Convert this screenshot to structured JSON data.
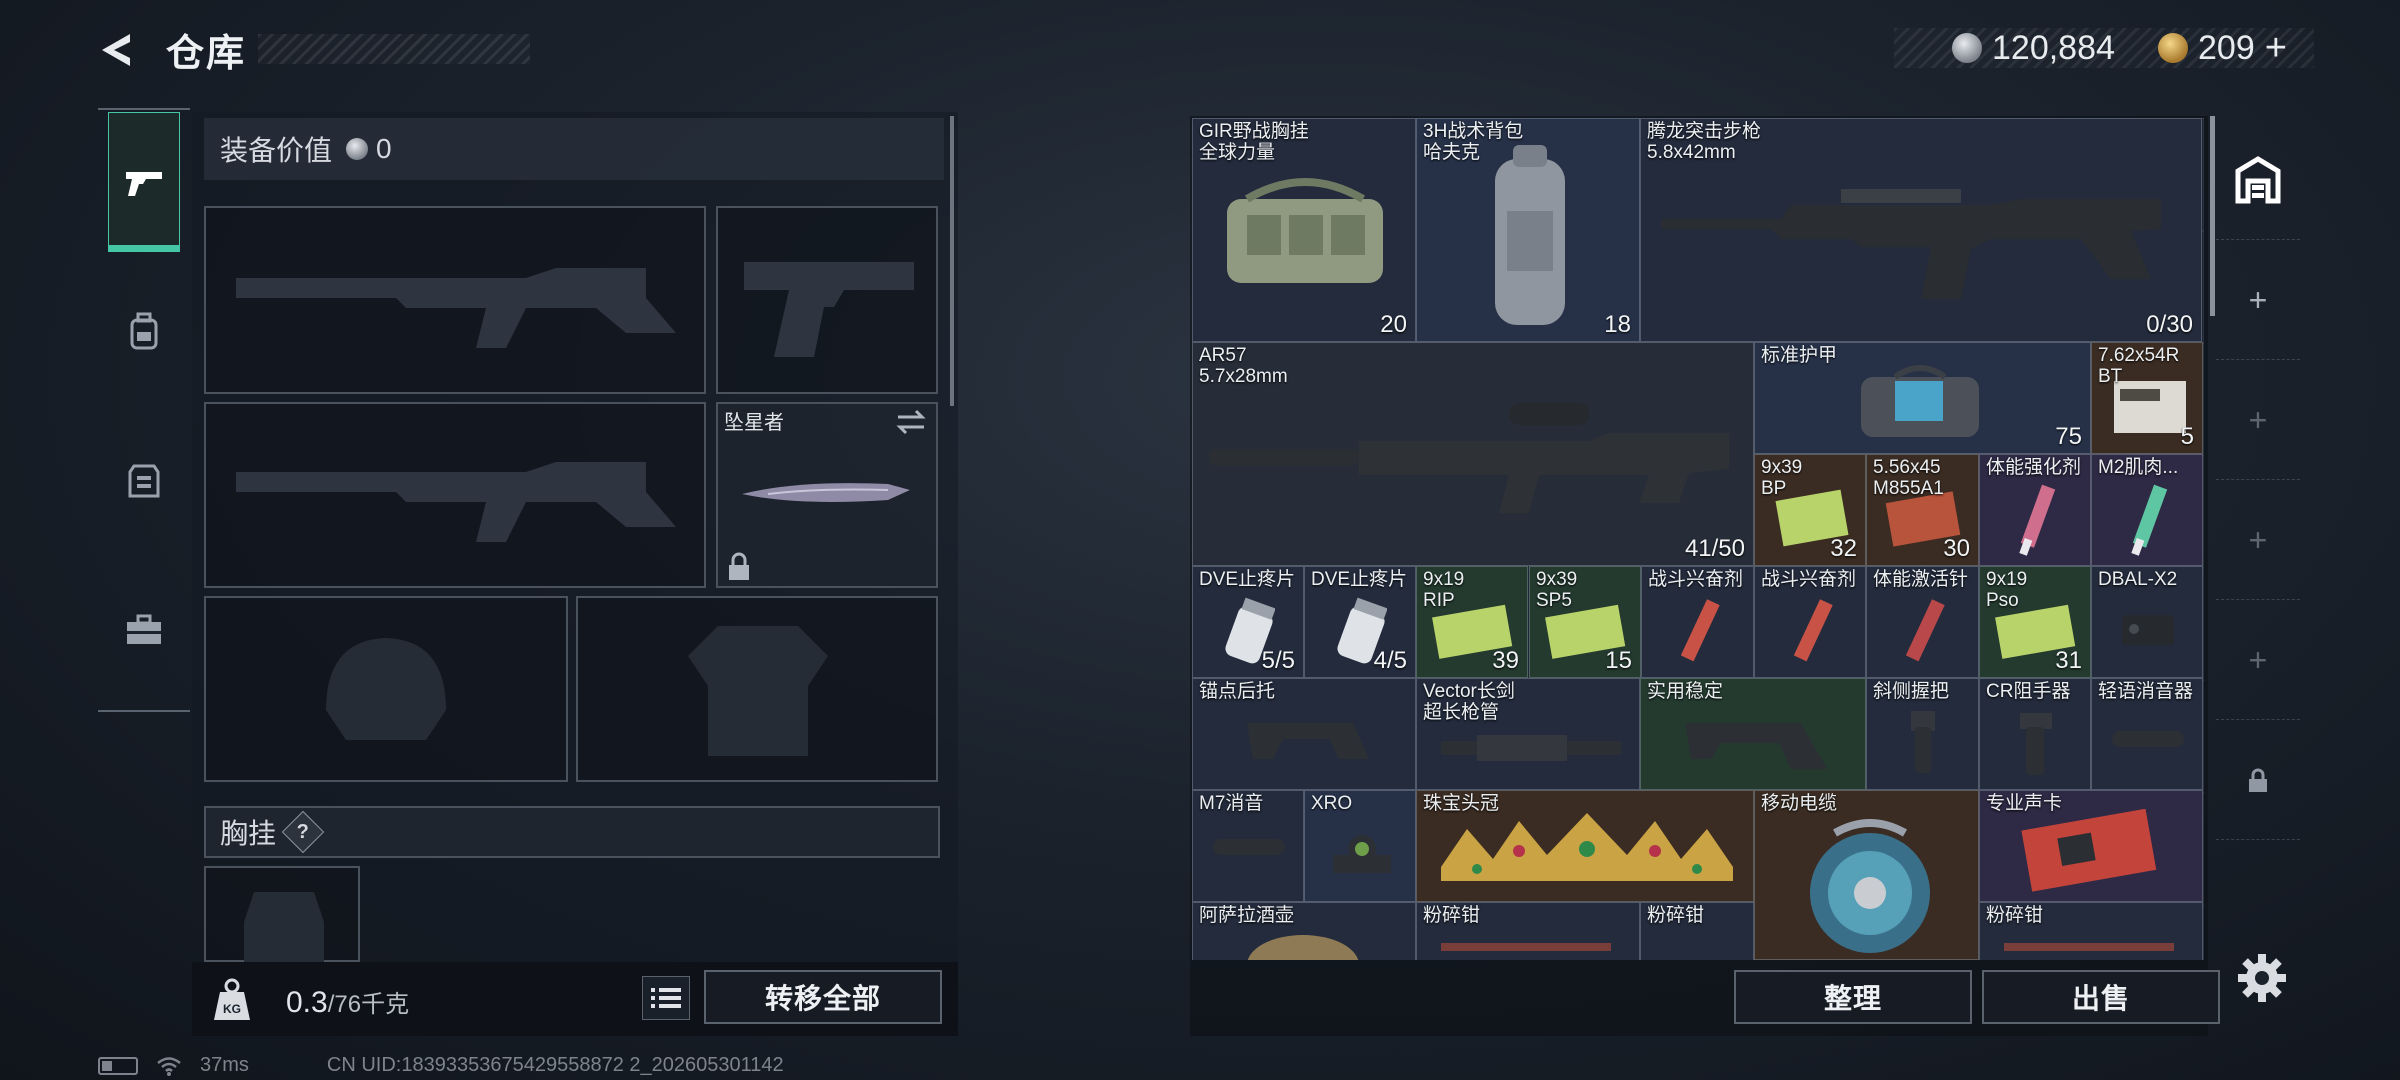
{
  "header": {
    "title": "仓库",
    "currency_silver": "120,884",
    "currency_gold": "209",
    "add_symbol": "+"
  },
  "left_tabs": [
    {
      "icon": "pistol-icon",
      "active": true
    },
    {
      "icon": "backpack-icon",
      "active": false
    },
    {
      "icon": "vest-icon",
      "active": false
    },
    {
      "icon": "toolbox-icon",
      "active": false
    }
  ],
  "loadout": {
    "equip_value_label": "装备价值",
    "equip_value": "0",
    "melee_label": "坠星者",
    "chest_label": "胸挂",
    "help_symbol": "?"
  },
  "footer_left": {
    "weight_current": "0.3",
    "weight_max": "/76千克",
    "transfer_all": "转移全部"
  },
  "items": [
    {
      "name": "GIR野战胸挂\n全球力量",
      "count": "20",
      "count_icon": "slots-icon"
    },
    {
      "name": "3H战术背包\n哈夫克",
      "count": "18",
      "count_icon": "bag-icon"
    },
    {
      "name": "腾龙突击步枪\n5.8x42mm",
      "count": "0/30"
    },
    {
      "name": "AR57\n5.7x28mm",
      "count": "41/50"
    },
    {
      "name": "标准护甲",
      "count": "75",
      "count_icon": "shield-icon"
    },
    {
      "name": "7.62x54R\nBT",
      "count": "5"
    },
    {
      "name": "9x39\nBP",
      "count": "32"
    },
    {
      "name": "5.56x45\nM855A1",
      "count": "30"
    },
    {
      "name": "体能强化剂",
      "count": ""
    },
    {
      "name": "M2肌肉...",
      "count": ""
    },
    {
      "name": "DVE止疼片",
      "count": "5/5"
    },
    {
      "name": "DVE止疼片",
      "count": "4/5"
    },
    {
      "name": "9x19\nRIP",
      "count": "39"
    },
    {
      "name": "9x39\nSP5",
      "count": "15"
    },
    {
      "name": "战斗兴奋剂",
      "count": ""
    },
    {
      "name": "战斗兴奋剂",
      "count": ""
    },
    {
      "name": "体能激活针",
      "count": ""
    },
    {
      "name": "9x19\nPso",
      "count": "31"
    },
    {
      "name": "DBAL-X2",
      "count": ""
    },
    {
      "name": "锚点后托",
      "count": ""
    },
    {
      "name": "Vector长剑\n超长枪管",
      "count": ""
    },
    {
      "name": "实用稳定",
      "count": ""
    },
    {
      "name": "斜侧握把",
      "count": ""
    },
    {
      "name": "CR阻手器",
      "count": ""
    },
    {
      "name": "轻语消音器",
      "count": ""
    },
    {
      "name": "M7消音",
      "count": ""
    },
    {
      "name": "XRO",
      "count": ""
    },
    {
      "name": "珠宝头冠",
      "count": ""
    },
    {
      "name": "移动电缆",
      "count": ""
    },
    {
      "name": "专业声卡",
      "count": ""
    },
    {
      "name": "阿萨拉酒壶",
      "count": ""
    },
    {
      "name": "粉碎钳",
      "count": ""
    },
    {
      "name": "粉碎钳",
      "count": ""
    },
    {
      "name": "粉碎钳",
      "count": ""
    }
  ],
  "actions": {
    "tidy": "整理",
    "sell": "出售"
  },
  "dock": {
    "add_symbol": "+"
  },
  "status": {
    "ping": "37ms",
    "uid": "CN UID:18393353675429558872 2_202605301142"
  }
}
